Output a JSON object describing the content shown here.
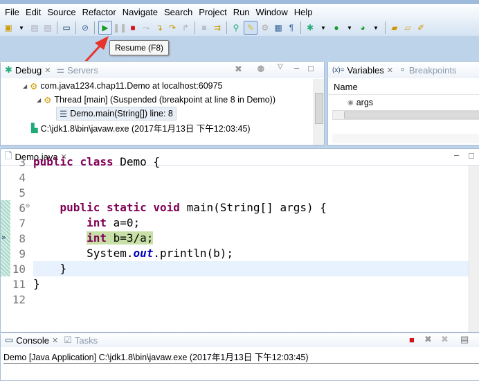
{
  "menu": [
    "File",
    "Edit",
    "Source",
    "Refactor",
    "Navigate",
    "Search",
    "Project",
    "Run",
    "Window",
    "Help"
  ],
  "tooltip": "Resume (F8)",
  "debug_panel": {
    "tabs": [
      {
        "label": "Debug",
        "active": true
      },
      {
        "label": "Servers",
        "active": false
      }
    ],
    "tree": [
      "com.java1234.chap11.Demo at localhost:60975",
      "Thread [main] (Suspended (breakpoint at line 8 in Demo))",
      "Demo.main(String[]) line: 8",
      "C:\\jdk1.8\\bin\\javaw.exe (2017年1月13日 下午12:03:45)"
    ]
  },
  "variables_panel": {
    "tabs": [
      {
        "label": "Variables",
        "prefix": "(x)=",
        "active": true
      },
      {
        "label": "Breakpoints",
        "active": false
      }
    ],
    "column": "Name",
    "rows": [
      "args"
    ]
  },
  "editor": {
    "tab": "Demo.java",
    "lines": [
      {
        "n": "3",
        "parts": [
          [
            "kw",
            "public "
          ],
          [
            "kw",
            "class "
          ],
          [
            "",
            "Demo {"
          ]
        ]
      },
      {
        "n": "4",
        "parts": []
      },
      {
        "n": "5",
        "parts": []
      },
      {
        "n": "6",
        "parts": [
          [
            "",
            "    "
          ],
          [
            "kw",
            "public "
          ],
          [
            "kw",
            "static "
          ],
          [
            "kw",
            "void "
          ],
          [
            "",
            "main(String[] args) {"
          ]
        ]
      },
      {
        "n": "7",
        "parts": [
          [
            "",
            "        "
          ],
          [
            "kw",
            "int "
          ],
          [
            "",
            "a=0;"
          ]
        ]
      },
      {
        "n": "8",
        "parts": [
          [
            "",
            "        "
          ],
          [
            "kw",
            "int "
          ],
          [
            "",
            "b=3/a;"
          ]
        ]
      },
      {
        "n": "9",
        "parts": [
          [
            "",
            "        System."
          ],
          [
            "st",
            "out"
          ],
          [
            "",
            ".println(b);"
          ]
        ]
      },
      {
        "n": "10",
        "parts": [
          [
            "",
            "    }"
          ]
        ]
      },
      {
        "n": "11",
        "parts": [
          [
            "",
            "}"
          ]
        ]
      },
      {
        "n": "12",
        "parts": []
      }
    ],
    "breakpoint_line": "8",
    "current_line": "10"
  },
  "console_panel": {
    "tabs": [
      {
        "label": "Console",
        "active": true
      },
      {
        "label": "Tasks",
        "active": false
      }
    ],
    "text": "Demo [Java Application] C:\\jdk1.8\\bin\\javaw.exe (2017年1月13日 下午12:03:45)"
  },
  "colors": {
    "highlight": "#c8e0a8",
    "current_line": "#e8f2fe",
    "arrow": "#e8322c"
  }
}
